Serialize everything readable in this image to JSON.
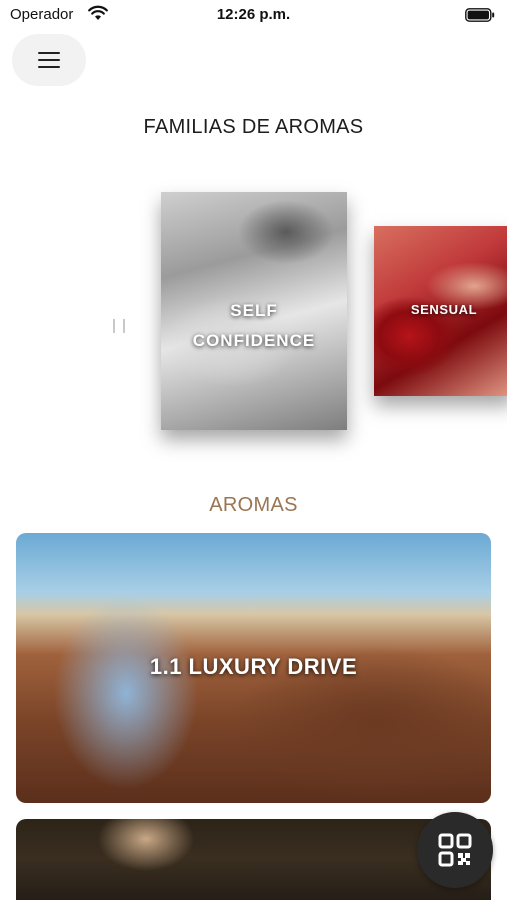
{
  "status_bar": {
    "carrier": "Operador",
    "time": "12:26 p.m.",
    "icons": [
      "wifi-icon",
      "battery-icon"
    ]
  },
  "header": {
    "menu_icon": "hamburger-menu-icon"
  },
  "families": {
    "title": "FAMILIAS DE AROMAS",
    "cards": [
      {
        "label_line1": "SELF",
        "label_line2": "CONFIDENCE"
      },
      {
        "label": "SENSUAL"
      }
    ]
  },
  "aromas": {
    "title": "AROMAS",
    "items": [
      {
        "label": "1.1 LUXURY DRIVE"
      },
      {
        "label": ""
      }
    ]
  },
  "qr_button": {
    "icon": "qr-code-icon"
  },
  "colors": {
    "aromas_title": "#9a7552",
    "menu_button_bg": "#f2f2f2",
    "qr_button_bg": "#2a2a2a"
  }
}
